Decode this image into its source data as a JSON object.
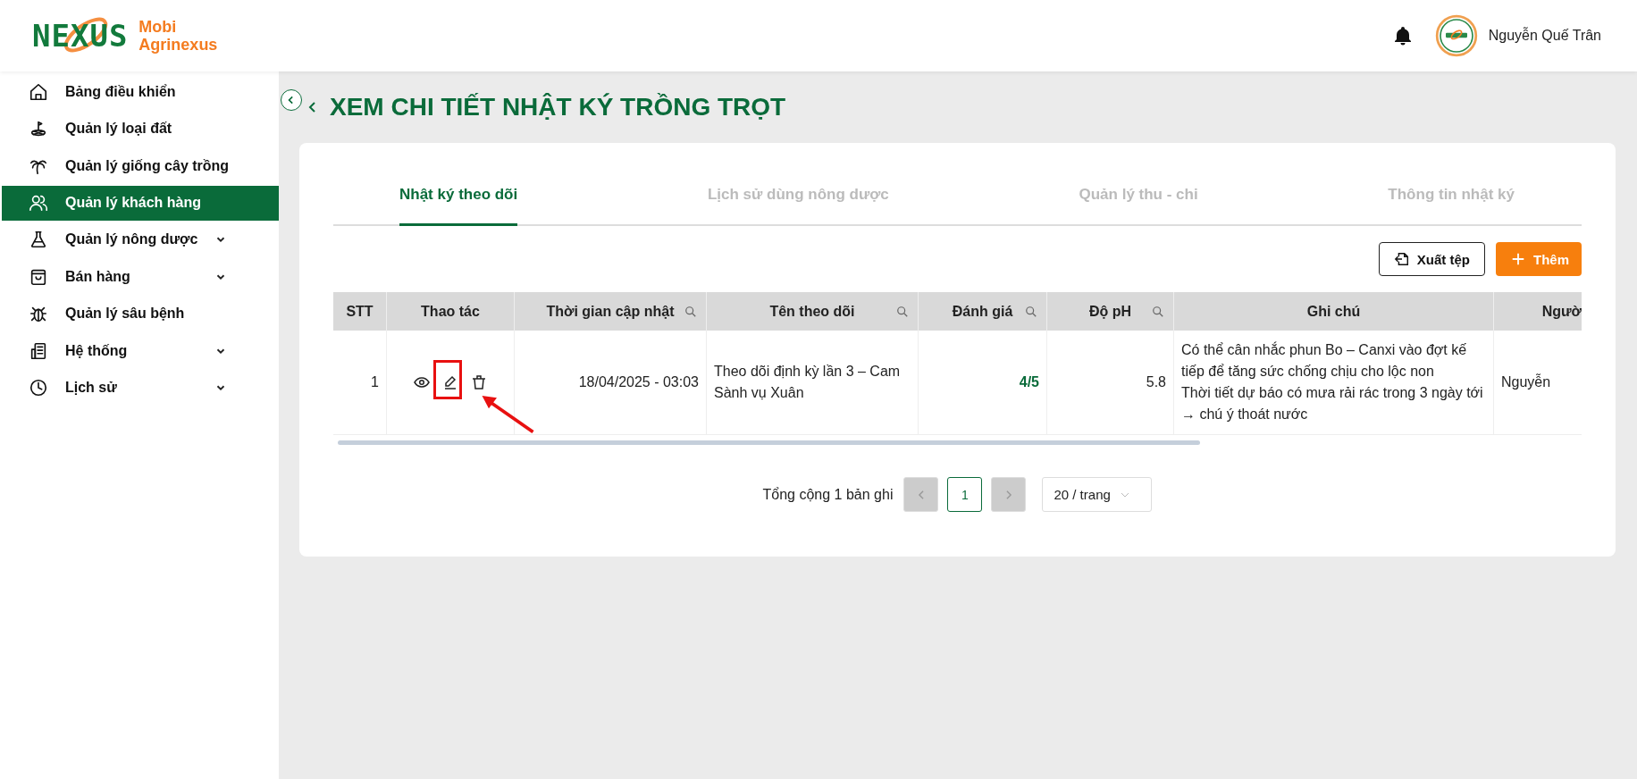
{
  "brand": {
    "logo_text": "NEXUS",
    "line1": "Mobi",
    "line2": "Agrinexus"
  },
  "user": {
    "name": "Nguyễn Quế Trân"
  },
  "sidebar": {
    "items": [
      {
        "label": "Bảng điều khiển",
        "selected": false,
        "has_submenu": false
      },
      {
        "label": "Quản lý loại đất",
        "selected": false,
        "has_submenu": false
      },
      {
        "label": "Quản lý giống cây trồng",
        "selected": false,
        "has_submenu": false
      },
      {
        "label": "Quản lý khách hàng",
        "selected": true,
        "has_submenu": false
      },
      {
        "label": "Quản lý nông dược",
        "selected": false,
        "has_submenu": true
      },
      {
        "label": "Bán hàng",
        "selected": false,
        "has_submenu": true
      },
      {
        "label": "Quản lý sâu bệnh",
        "selected": false,
        "has_submenu": false
      },
      {
        "label": "Hệ thống",
        "selected": false,
        "has_submenu": true
      },
      {
        "label": "Lịch sử",
        "selected": false,
        "has_submenu": true
      }
    ]
  },
  "page": {
    "title": "XEM CHI TIẾT NHẬT KÝ TRỒNG TRỌT"
  },
  "tabs": [
    {
      "label": "Nhật ký theo dõi",
      "selected": true
    },
    {
      "label": "Lịch sử dùng nông dược",
      "selected": false
    },
    {
      "label": "Quản lý thu - chi",
      "selected": false
    },
    {
      "label": "Thông tin nhật ký",
      "selected": false
    }
  ],
  "toolbar": {
    "buttons": [
      {
        "label": "Xuất tệp",
        "kind": "export"
      },
      {
        "label": "Thêm",
        "kind": "add"
      }
    ]
  },
  "table": {
    "columns": [
      {
        "label": "STT",
        "kind": "index",
        "searchable": false
      },
      {
        "label": "Thao tác",
        "kind": "actions",
        "searchable": false
      },
      {
        "label": "Thời gian cập nhật",
        "kind": "number",
        "searchable": true
      },
      {
        "label": "Tên theo dõi",
        "kind": "text",
        "searchable": true
      },
      {
        "label": "Đánh giá",
        "kind": "rating",
        "searchable": true
      },
      {
        "label": "Độ pH",
        "kind": "number",
        "searchable": true
      },
      {
        "label": "Ghi chú",
        "kind": "text",
        "searchable": false
      },
      {
        "label": "Ngườ",
        "kind": "text",
        "searchable": false
      }
    ],
    "rows": [
      {
        "cells": [
          "1",
          "",
          "18/04/2025 - 03:03",
          "Theo dõi định kỳ lần 3 – Cam Sành vụ Xuân",
          "4/5",
          "5.8",
          [
            "Có thể cân nhắc phun Bo – Canxi vào đợt kế tiếp để tăng sức chống chịu cho lộc non",
            "Thời tiết dự báo có mưa rải rác trong 3 ngày tới → chú ý thoát nước"
          ],
          "Nguyễn"
        ]
      }
    ]
  },
  "pagination": {
    "summary": "Tổng cộng 1 bản ghi",
    "prev_disabled": true,
    "next_disabled": true,
    "pages": [
      {
        "label": "1",
        "selected": true
      }
    ],
    "page_size": "20 / trang"
  }
}
